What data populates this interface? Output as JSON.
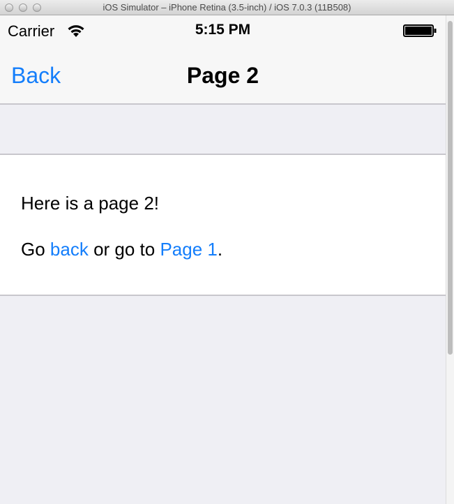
{
  "window": {
    "title": "iOS Simulator – iPhone Retina (3.5-inch) / iOS 7.0.3 (11B508)"
  },
  "status_bar": {
    "carrier": "Carrier",
    "time": "5:15 PM",
    "wifi_icon": "wifi-icon",
    "battery_icon": "battery-icon"
  },
  "nav_bar": {
    "back_label": "Back",
    "title": "Page 2"
  },
  "content": {
    "line1": "Here is a page 2!",
    "line2_prefix": "Go ",
    "link_back": "back",
    "line2_middle": " or go to ",
    "link_page1": "Page 1",
    "line2_suffix": "."
  },
  "colors": {
    "ios_blue": "#147efb",
    "background": "#efeff4",
    "separator": "#c8c7cc"
  }
}
